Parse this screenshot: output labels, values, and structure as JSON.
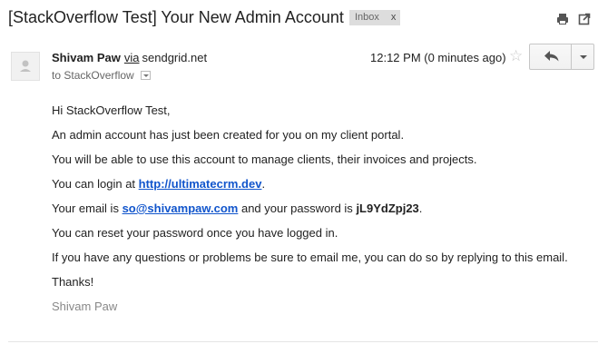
{
  "email": {
    "subject": "[StackOverflow Test] Your New Admin Account",
    "label": "Inbox",
    "label_remove": "x",
    "sender_name": "Shivam Paw",
    "via_text": "via",
    "via_domain": "sendgrid.net",
    "to_prefix": "to",
    "to_name": "StackOverflow",
    "time": "12:12 PM (0 minutes ago)",
    "star": "☆"
  },
  "body": {
    "greeting": "Hi StackOverflow Test,",
    "line1": "An admin account has just been created for you on my client portal.",
    "line2": "You will be able to use this account to manage clients, their invoices and projects.",
    "login_prefix": "You can login at ",
    "login_link": "http://ultimatecrm.dev",
    "login_suffix": ".",
    "email_prefix": "Your email is ",
    "email_link": "so@shivampaw.com",
    "email_middle": " and your password is ",
    "password": "jL9YdZpj23",
    "email_suffix": ".",
    "line_reset": "You can reset your password once you have logged in.",
    "line_questions": "If you have any questions or problems be sure to email me, you can do so by replying to this email.",
    "thanks": "Thanks!",
    "signature": "Shivam Paw"
  },
  "colors": {
    "link": "#1155cc",
    "signature": "#888888",
    "label_bg": "#dddddd"
  },
  "icons": {
    "print": "print-icon",
    "new_window": "new-window-icon",
    "star": "star-icon",
    "reply": "reply-icon",
    "more": "chevron-down-icon",
    "avatar": "avatar-icon"
  }
}
